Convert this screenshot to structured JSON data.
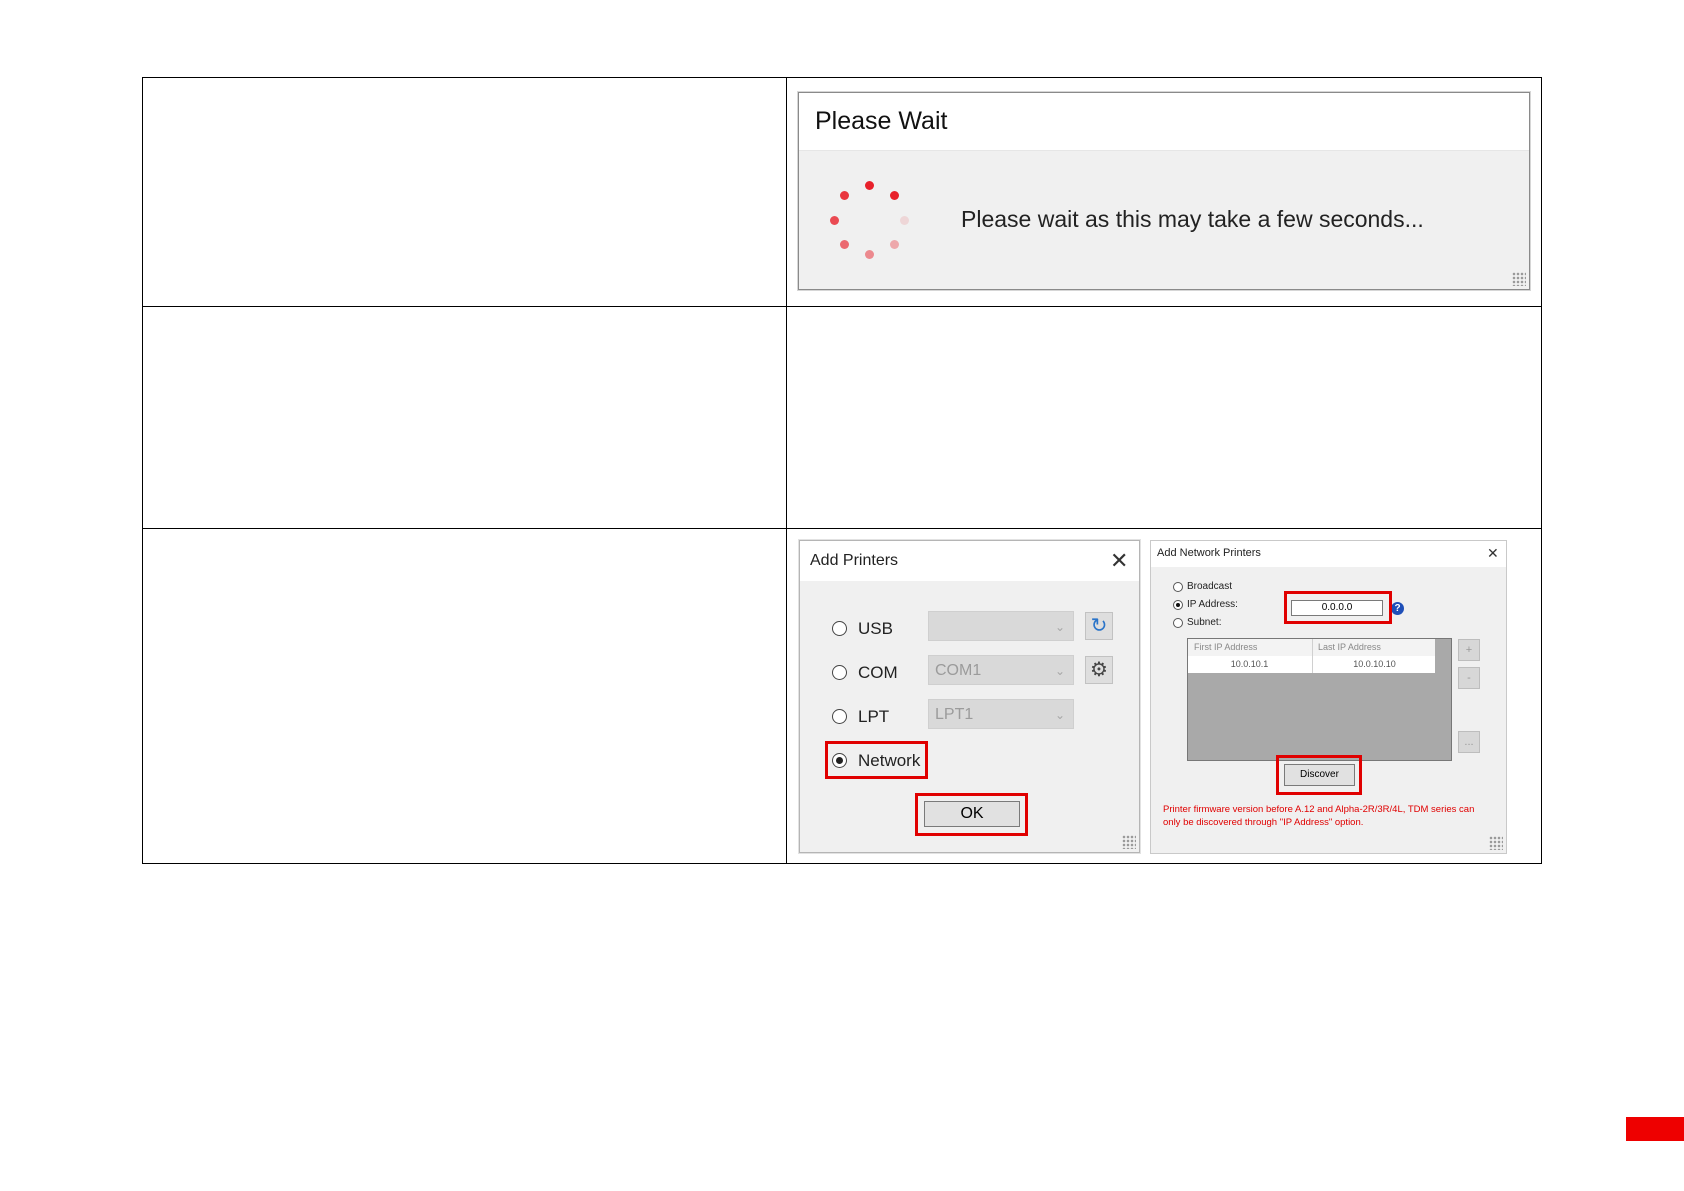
{
  "please_wait": {
    "title": "Please Wait",
    "message": "Please wait as this may take a few seconds..."
  },
  "add_printers": {
    "title": "Add Printers",
    "close_glyph": "✕",
    "options": [
      {
        "label": "USB",
        "value": "",
        "selected": false,
        "action_icon": "refresh-icon"
      },
      {
        "label": "COM",
        "value": "COM1",
        "selected": false,
        "action_icon": "gear-icon"
      },
      {
        "label": "LPT",
        "value": "LPT1",
        "selected": false
      },
      {
        "label": "Network",
        "selected": true
      }
    ],
    "ok_label": "OK"
  },
  "add_network_printers": {
    "title": "Add Network Printers",
    "close_glyph": "✕",
    "modes": [
      {
        "label": "Broadcast",
        "selected": false
      },
      {
        "label": "IP Address:",
        "selected": true
      },
      {
        "label": "Subnet:",
        "selected": false
      }
    ],
    "ip_value": "0.0.0.0",
    "help_glyph": "?",
    "table": {
      "columns": [
        "First IP Address",
        "Last IP Address"
      ],
      "rows": [
        [
          "10.0.10.1",
          "10.0.10.10"
        ]
      ]
    },
    "side_buttons": [
      "+",
      "-",
      "..."
    ],
    "discover_label": "Discover",
    "note": "Printer firmware version before A.12 and Alpha-2R/3R/4L, TDM series can only be discovered through \"IP Address\" option."
  },
  "colors": {
    "highlight": "#e00000",
    "spinner": "#e8212b",
    "page_tab": "#ee0000"
  }
}
